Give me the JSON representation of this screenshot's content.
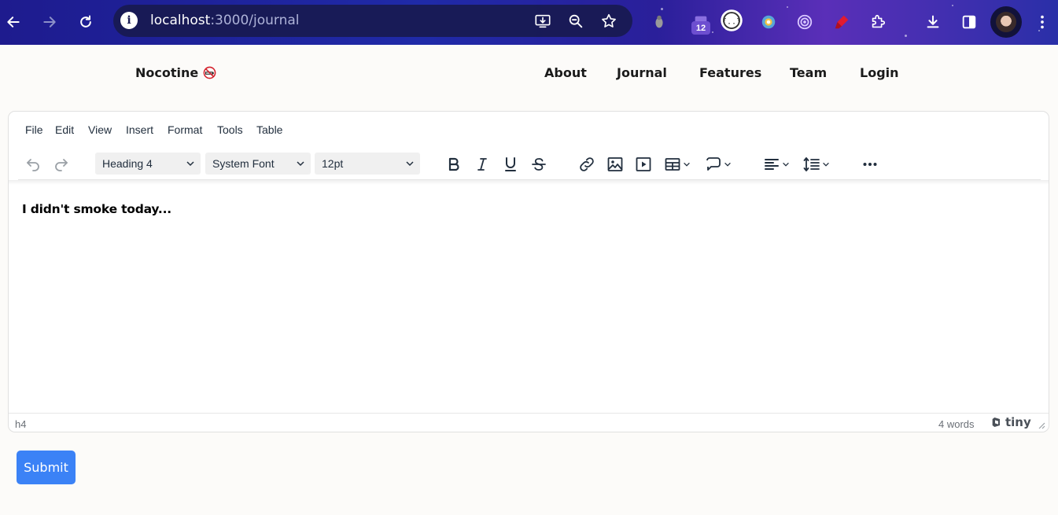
{
  "browser": {
    "url_host": "localhost",
    "url_path": ":3000/journal",
    "extension_badge": "12"
  },
  "site": {
    "brand": "Nocotine",
    "brand_icon": "no-smoking-icon",
    "nav": [
      "About",
      "Journal",
      "Features",
      "Team",
      "Login"
    ]
  },
  "editor": {
    "menu": [
      "File",
      "Edit",
      "View",
      "Insert",
      "Format",
      "Tools",
      "Table"
    ],
    "block_format": "Heading 4",
    "font_family": "System Font",
    "font_size": "12pt",
    "content": "I didn't smoke today...",
    "status_path": "h4",
    "word_count": "4 words",
    "brand": "tiny"
  },
  "submit_label": "Submit"
}
